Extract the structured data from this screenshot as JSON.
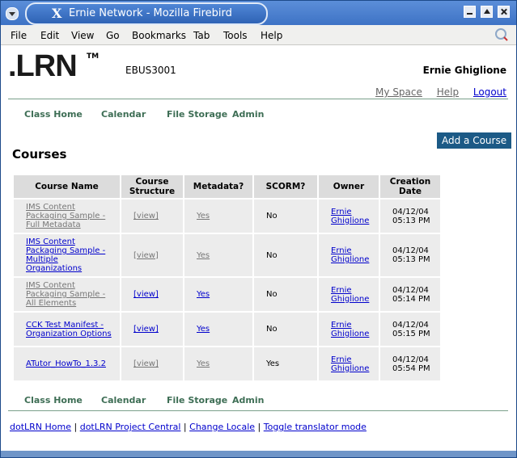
{
  "window": {
    "title": "Ernie Network - Mozilla Firebird",
    "title_icon": "X"
  },
  "menubar": [
    "File",
    "Edit",
    "View",
    "Go",
    "Bookmarks",
    "Tab",
    "Tools",
    "Help"
  ],
  "header": {
    "logo": ".LRN",
    "logo_tm": "TM",
    "course_code": "EBUS3001",
    "user_name": "Ernie Ghiglione",
    "links": [
      "My Space",
      "Help",
      "Logout"
    ]
  },
  "nav_top": [
    "Class Home",
    "Calendar",
    "File Storage",
    "Admin"
  ],
  "nav_bottom": [
    "Class Home",
    "Calendar",
    "File Storage",
    "Admin"
  ],
  "add_course_label": "Add a Course",
  "page_title": "Courses",
  "table": {
    "headers": [
      "Course Name",
      "Course Structure",
      "Metadata?",
      "SCORM?",
      "Owner",
      "Creation Date"
    ],
    "rows": [
      {
        "name": "IMS Content Packaging Sample - Full Metadata",
        "structure": "[view]",
        "metadata": "Yes",
        "scorm": "No",
        "owner": "Ernie Ghiglione",
        "date": "04/12/04 05:13 PM",
        "grey": true
      },
      {
        "name": "IMS Content Packaging Sample - Multiple Organizations",
        "structure": "[view]",
        "metadata": "Yes",
        "scorm": "No",
        "owner": "Ernie Ghiglione",
        "date": "04/12/04 05:13 PM",
        "grey": false
      },
      {
        "name": "IMS Content Packaging Sample - All Elements",
        "structure": "[view]",
        "metadata": "Yes",
        "scorm": "No",
        "owner": "Ernie Ghiglione",
        "date": "04/12/04 05:14 PM",
        "grey": true
      },
      {
        "name": "CCK Test Manifest - Organization Options",
        "structure": "[view]",
        "metadata": "Yes",
        "scorm": "No",
        "owner": "Ernie Ghiglione",
        "date": "04/12/04 05:15 PM",
        "grey": false
      },
      {
        "name": "ATutor_HowTo_1.3.2",
        "structure": "[view]",
        "metadata": "Yes",
        "scorm": "Yes",
        "owner": "Ernie Ghiglione",
        "date": "04/12/04 05:54 PM",
        "grey": false
      }
    ]
  },
  "footer": [
    "dotLRN Home",
    "dotLRN Project Central",
    "Change Locale",
    "Toggle translator mode"
  ],
  "colors": {
    "accent": "#1c5a86",
    "nav": "#3e6e55",
    "link": "#0000cc"
  }
}
